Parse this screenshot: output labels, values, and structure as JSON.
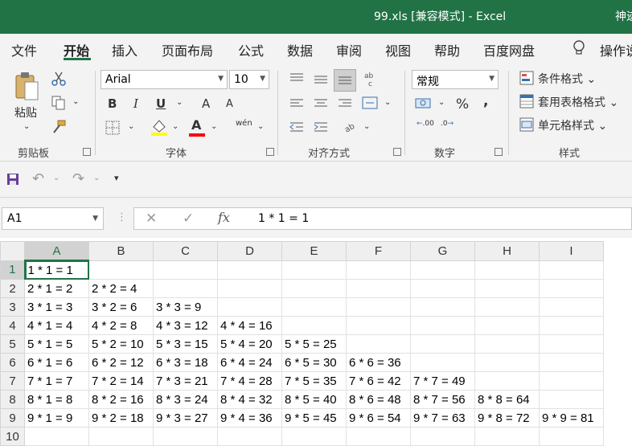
{
  "window": {
    "title": "99.xls  [兼容模式]  -  Excel",
    "user": "神迹"
  },
  "tabs": [
    "文件",
    "开始",
    "插入",
    "页面布局",
    "公式",
    "数据",
    "审阅",
    "视图",
    "帮助",
    "百度网盘"
  ],
  "active_tab": "开始",
  "tell_me": "操作说",
  "ribbon": {
    "clipboard": {
      "paste_label": "粘贴",
      "group_label": "剪贴板"
    },
    "font": {
      "name": "Arial",
      "size": "10",
      "bold": "B",
      "italic": "I",
      "underline": "U",
      "increase": "A",
      "decrease": "A",
      "color_letter": "A",
      "phonetic": "wén",
      "group_label": "字体"
    },
    "alignment": {
      "group_label": "对齐方式"
    },
    "number": {
      "format": "常规",
      "percent": "%",
      "comma": ",",
      "inc_decimal": ".00",
      "dec_decimal": ".0",
      "group_label": "数字"
    },
    "styles": {
      "conditional": "条件格式",
      "table": "套用表格格式",
      "cell": "单元格样式",
      "group_label": "样式"
    }
  },
  "colors": {
    "brand": "#217346",
    "highlight": "#FFFF00",
    "font_color": "#FF0000"
  },
  "formula_bar": {
    "name_box": "A1",
    "fx": "fx",
    "content": "1 * 1 = 1"
  },
  "sheet": {
    "columns": [
      "A",
      "B",
      "C",
      "D",
      "E",
      "F",
      "G",
      "H",
      "I"
    ],
    "rows": [
      {
        "num": "1",
        "cells": [
          "1 * 1 = 1",
          "",
          "",
          "",
          "",
          "",
          "",
          "",
          ""
        ]
      },
      {
        "num": "2",
        "cells": [
          "2 * 1 = 2",
          "2 * 2 = 4",
          "",
          "",
          "",
          "",
          "",
          "",
          ""
        ]
      },
      {
        "num": "3",
        "cells": [
          "3 * 1 = 3",
          "3 * 2 = 6",
          "3 * 3 = 9",
          "",
          "",
          "",
          "",
          "",
          ""
        ]
      },
      {
        "num": "4",
        "cells": [
          "4 * 1 = 4",
          "4 * 2 = 8",
          "4 * 3 = 12",
          "4 * 4 = 16",
          "",
          "",
          "",
          "",
          ""
        ]
      },
      {
        "num": "5",
        "cells": [
          "5 * 1 = 5",
          "5 * 2 = 10",
          "5 * 3 = 15",
          "5 * 4 = 20",
          "5 * 5 = 25",
          "",
          "",
          "",
          ""
        ]
      },
      {
        "num": "6",
        "cells": [
          "6 * 1 = 6",
          "6 * 2 = 12",
          "6 * 3 = 18",
          "6 * 4 = 24",
          "6 * 5 = 30",
          "6 * 6 = 36",
          "",
          "",
          ""
        ]
      },
      {
        "num": "7",
        "cells": [
          "7 * 1 = 7",
          "7 * 2 = 14",
          "7 * 3 = 21",
          "7 * 4 = 28",
          "7 * 5 = 35",
          "7 * 6 = 42",
          "7 * 7 = 49",
          "",
          ""
        ]
      },
      {
        "num": "8",
        "cells": [
          "8 * 1 = 8",
          "8 * 2 = 16",
          "8 * 3 = 24",
          "8 * 4 = 32",
          "8 * 5 = 40",
          "8 * 6 = 48",
          "8 * 7 = 56",
          "8 * 8 = 64",
          ""
        ]
      },
      {
        "num": "9",
        "cells": [
          "9 * 1 = 9",
          "9 * 2 = 18",
          "9 * 3 = 27",
          "9 * 4 = 36",
          "9 * 5 = 45",
          "9 * 6 = 54",
          "9 * 7 = 63",
          "9 * 8 = 72",
          "9 * 9 = 81"
        ]
      },
      {
        "num": "10",
        "cells": [
          "",
          "",
          "",
          "",
          "",
          "",
          "",
          "",
          ""
        ]
      }
    ]
  }
}
